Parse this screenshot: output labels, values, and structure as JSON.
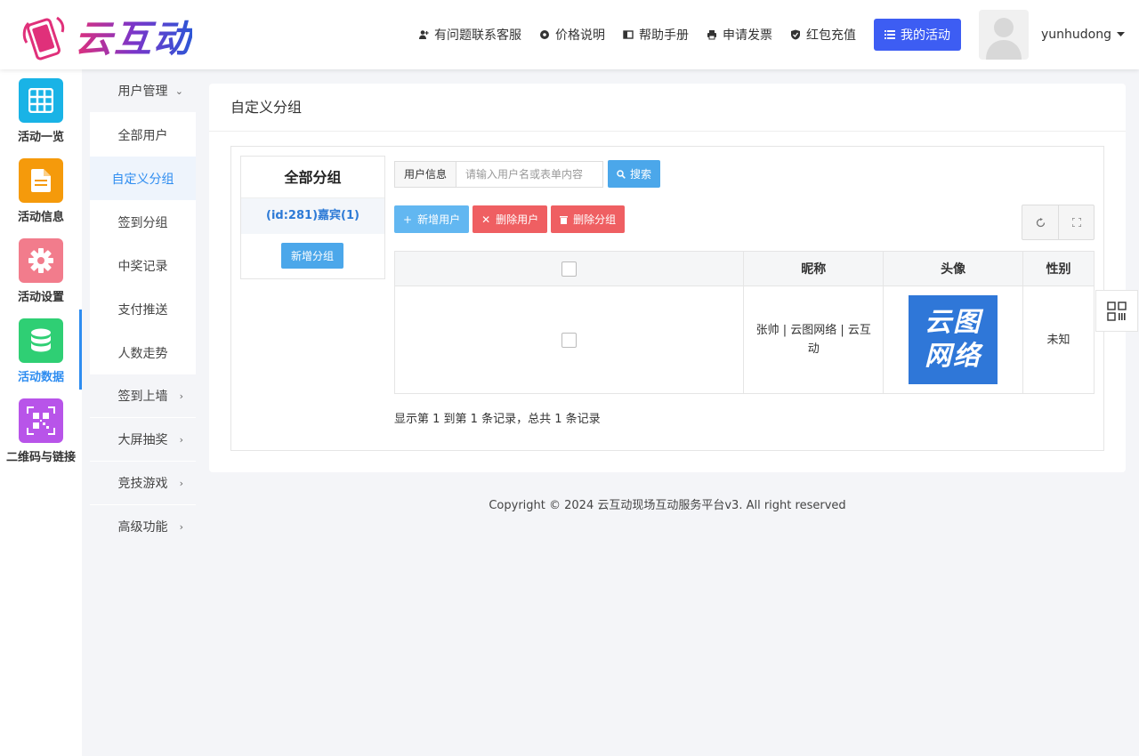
{
  "brand": {
    "name": "云互动"
  },
  "topnav": {
    "items": [
      {
        "label": "有问题联系客服",
        "icon": "user-plus-icon"
      },
      {
        "label": "价格说明",
        "icon": "settings-icon"
      },
      {
        "label": "帮助手册",
        "icon": "book-icon"
      },
      {
        "label": "申请发票",
        "icon": "printer-icon"
      },
      {
        "label": "红包充值",
        "icon": "shield-check-icon"
      }
    ],
    "my_activity": "我的活动",
    "username": "yunhudong"
  },
  "sidebar": {
    "items": [
      {
        "label": "活动一览",
        "icon": "grid-icon",
        "color": "#19b3e6"
      },
      {
        "label": "活动信息",
        "icon": "document-icon",
        "color": "#f59a0b"
      },
      {
        "label": "活动设置",
        "icon": "gear-icon",
        "color": "#f27c8c"
      },
      {
        "label": "活动数据",
        "icon": "database-icon",
        "color": "#2fcf74"
      },
      {
        "label": "二维码与链接",
        "icon": "qrcode-icon",
        "color": "#b854e9"
      }
    ]
  },
  "submenu": {
    "group_label": "用户管理",
    "items": [
      "全部用户",
      "自定义分组",
      "签到分组",
      "中奖记录",
      "支付推送",
      "人数走势"
    ],
    "groups": [
      "签到上墙",
      "大屏抽奖",
      "竞技游戏",
      "高级功能"
    ]
  },
  "main": {
    "title": "自定义分组",
    "groups_header": "全部分组",
    "group_item": "(id:281)嘉宾(1)",
    "add_group": "新增分组",
    "search": {
      "label": "用户信息",
      "placeholder": "请输入用户名或表单内容",
      "button": "搜索"
    },
    "actions": {
      "add_user": "新增用户",
      "delete_user": "删除用户",
      "delete_group": "删除分组"
    },
    "table": {
      "headers": [
        "",
        "昵称",
        "头像",
        "性别"
      ],
      "rows": [
        {
          "nickname": "张帅 | 云图网络 | 云互动",
          "avatar_text": [
            "云图",
            "网络"
          ],
          "gender": "未知"
        }
      ]
    },
    "summary": "显示第 1 到第 1 条记录，总共 1 条记录"
  },
  "footer": {
    "copyright": "Copyright © 2024 云互动现场互动服务平台v3. All right reserved"
  }
}
